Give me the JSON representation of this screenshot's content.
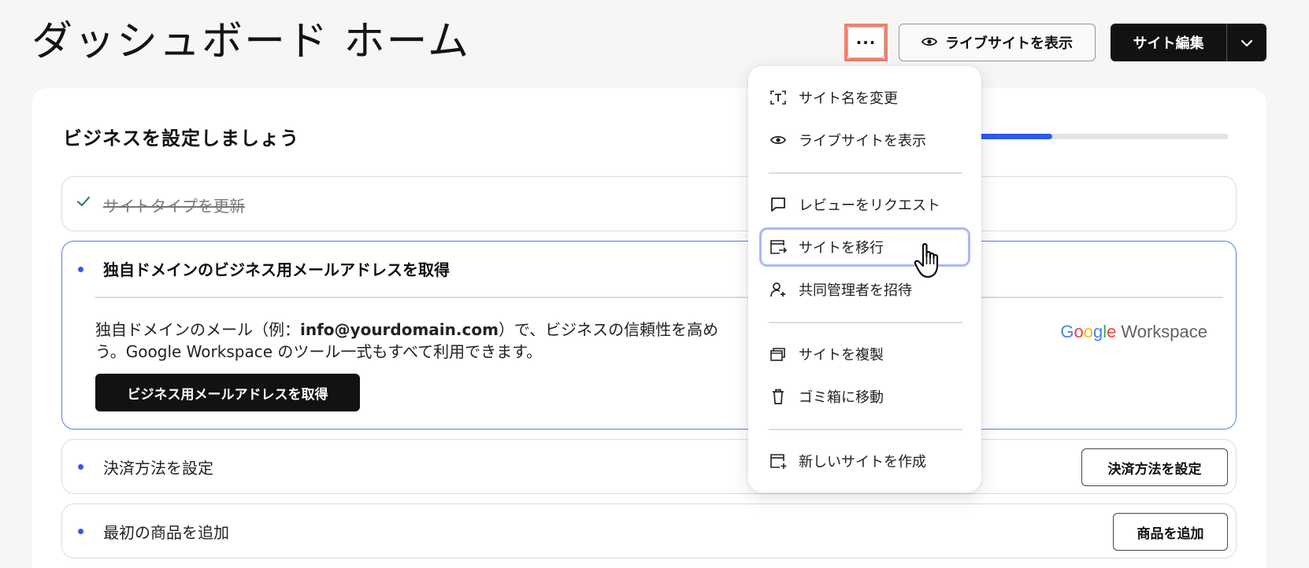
{
  "header": {
    "title": "ダッシュボード ホーム",
    "more_label": "···",
    "view_live_label": "ライブサイトを表示",
    "edit_label": "サイト編集"
  },
  "setup": {
    "title": "ビジネスを設定しましょう",
    "progress": 0.3,
    "tasks": [
      {
        "label": "サイトタイプを更新",
        "status": "done"
      },
      {
        "label": "独自ドメインのビジネス用メールアドレスを取得",
        "status": "expanded",
        "desc_part1": "独自ドメインのメール（例：",
        "desc_email": "info@yourdomain.com",
        "desc_part2": "）で、ビジネスの信頼性を高め",
        "desc_line2": "う。Google Workspace のツール一式もすべて利用できます。",
        "cta_label": "ビジネス用メールアドレスを取得",
        "logo_google": "Google",
        "logo_workspace": "Workspace"
      },
      {
        "label": "決済方法を設定",
        "status": "todo",
        "action_label": "決済方法を設定"
      },
      {
        "label": "最初の商品を追加",
        "status": "todo",
        "action_label": "商品を追加"
      }
    ]
  },
  "menu": {
    "items": [
      {
        "label": "サイト名を変更",
        "icon": "text-icon"
      },
      {
        "label": "ライブサイトを表示",
        "icon": "eye-icon"
      },
      {
        "label": "レビューをリクエスト",
        "icon": "chat-bubble-icon"
      },
      {
        "label": "サイトを移行",
        "icon": "transfer-icon",
        "active": true
      },
      {
        "label": "共同管理者を招待",
        "icon": "add-person-icon"
      },
      {
        "label": "サイトを複製",
        "icon": "duplicate-icon"
      },
      {
        "label": "ゴミ箱に移動",
        "icon": "trash-icon"
      },
      {
        "label": "新しいサイトを作成",
        "icon": "add-site-icon"
      }
    ]
  },
  "colors": {
    "accent": "#2f5bea",
    "highlight": "#f27f6d",
    "primary_button": "#121212"
  }
}
